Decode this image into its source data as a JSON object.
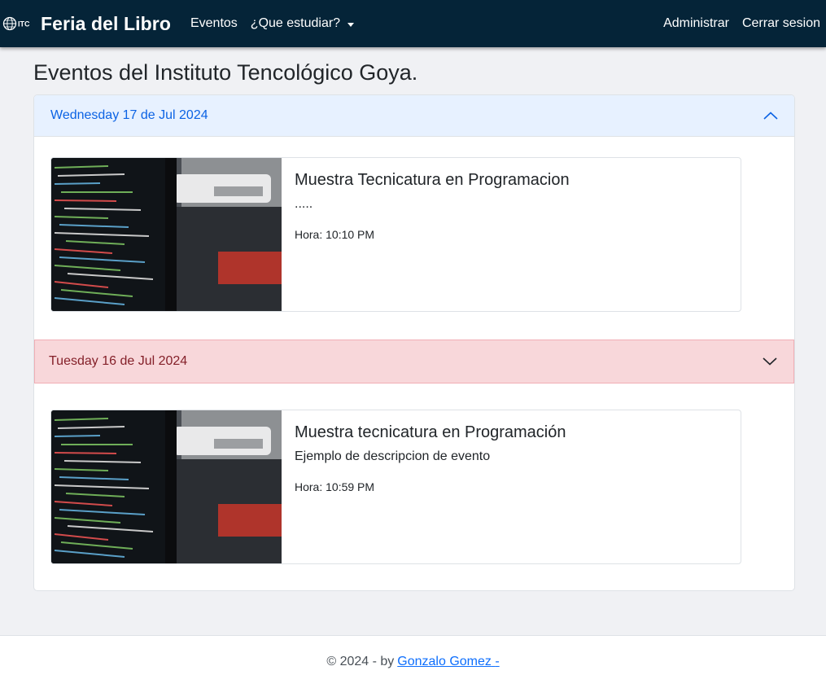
{
  "navbar": {
    "logo_text": "ITC",
    "brand": "Feria del Libro",
    "links": [
      "Eventos",
      "¿Que estudiar?"
    ],
    "right_links": [
      "Administrar",
      "Cerrar sesion"
    ]
  },
  "page": {
    "title": "Eventos del Instituto Tencológico Goya."
  },
  "accordion": [
    {
      "date": "Wednesday 17 de Jul 2024",
      "expanded": true,
      "event": {
        "title": "Muestra Tecnicatura en Programacion",
        "description": ".....",
        "time": "Hora: 10:10 PM"
      }
    },
    {
      "date": "Tuesday 16 de Jul 2024",
      "expanded": false,
      "event": {
        "title": "Muestra tecnicatura en Programación",
        "description": "Ejemplo de descripcion de evento",
        "time": "Hora: 10:59 PM"
      }
    }
  ],
  "footer": {
    "text": "© 2024 - by",
    "author_link": "Gonzalo Gomez",
    "suffix": "-"
  },
  "colors": {
    "navbar_bg": "#052438",
    "accordion_open_bg": "#e7f1ff",
    "accordion_open_text": "#0c63e4",
    "accordion_closed_bg": "#f8d7da",
    "accordion_closed_text": "#842029",
    "link": "#0d6efd"
  },
  "icons": [
    "itc-globe-logo-icon",
    "chevron-up-icon",
    "chevron-down-icon",
    "dropdown-caret-icon"
  ]
}
